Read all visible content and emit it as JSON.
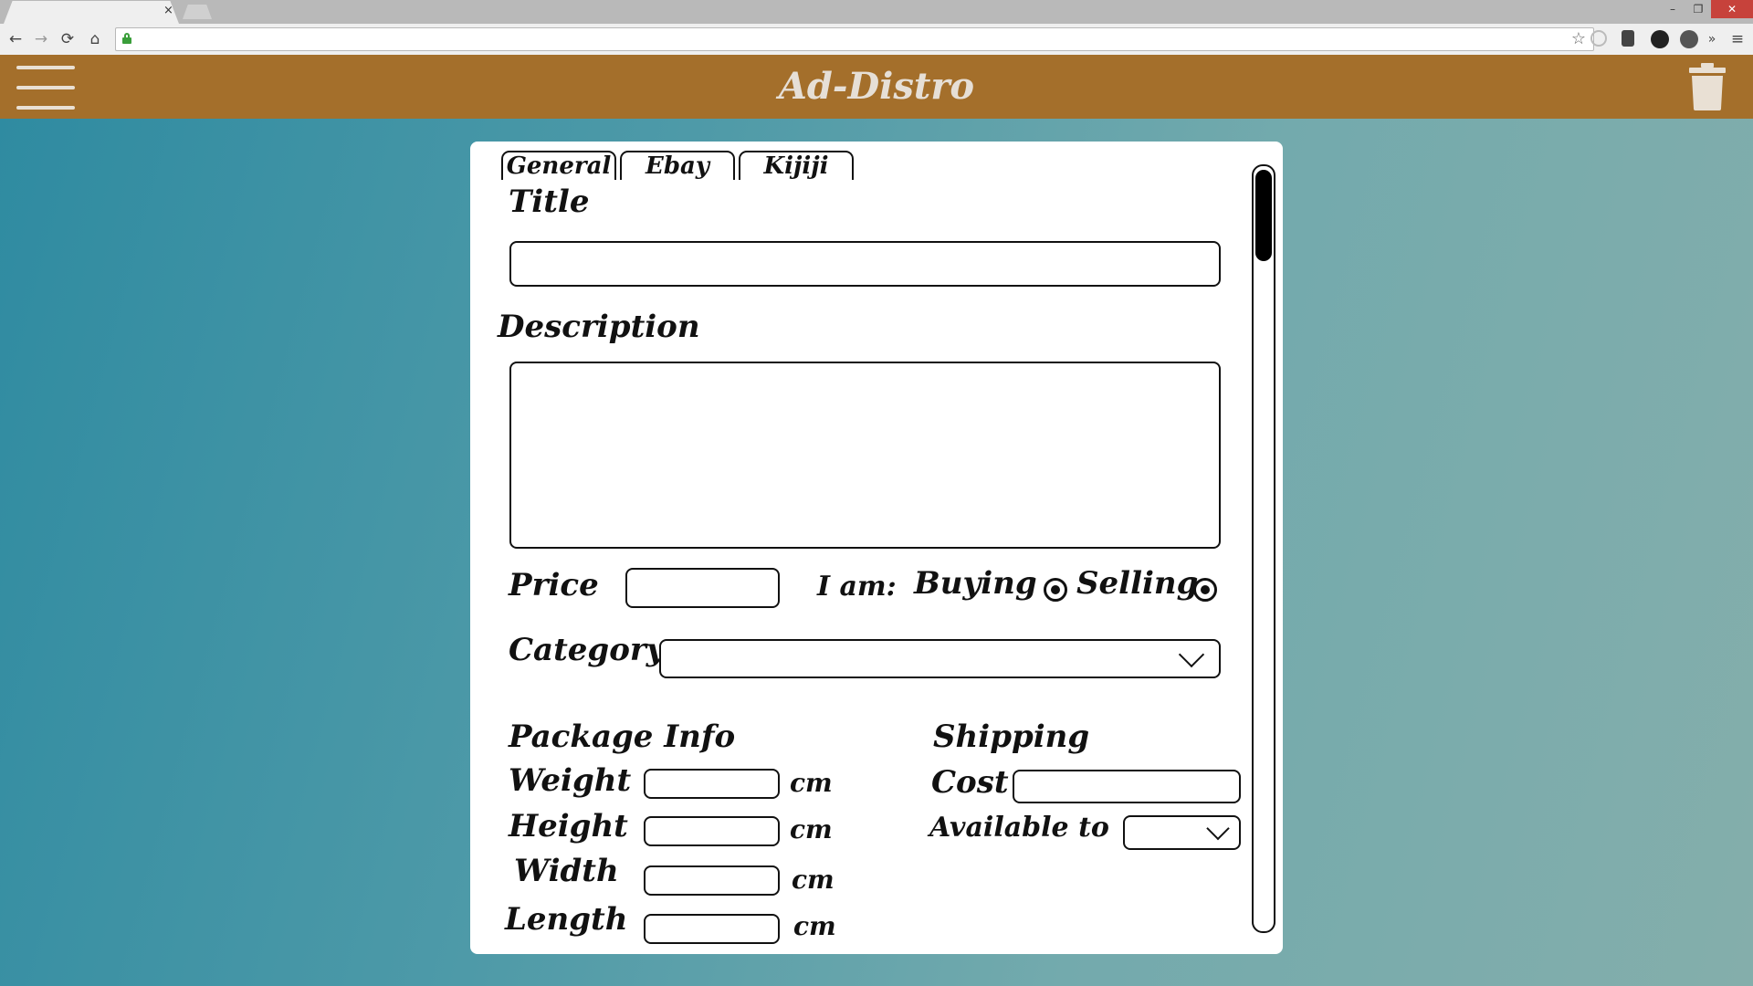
{
  "browser": {
    "tab_close": "×",
    "window_controls": {
      "minimize": "–",
      "maximize": "❐",
      "close": "✕"
    },
    "nav": {
      "back": "←",
      "forward": "→",
      "reload": "⟳",
      "home": "⌂"
    },
    "bookmark_star": "☆",
    "overflow": "»",
    "menu": "≡"
  },
  "app": {
    "title": "Ad-Distro",
    "colors": {
      "header": "#a46f2b",
      "header_text": "#e6dfd6"
    }
  },
  "form": {
    "tabs": [
      {
        "label": "General"
      },
      {
        "label": "Ebay"
      },
      {
        "label": "Kijiji"
      }
    ],
    "title_label": "Title",
    "title_value": "",
    "description_label": "Description",
    "description_value": "",
    "price_label": "Price",
    "price_value": "",
    "i_am_label": "I am:",
    "buying_label": "Buying",
    "selling_label": "Selling",
    "category_label": "Category",
    "category_value": "",
    "package_heading": "Package Info",
    "weight_label": "Weight",
    "height_label": "Height",
    "width_label": "Width",
    "length_label": "Length",
    "unit": "cm",
    "shipping_heading": "Shipping",
    "cost_label": "Cost",
    "available_label": "Available to",
    "available_value": ""
  }
}
